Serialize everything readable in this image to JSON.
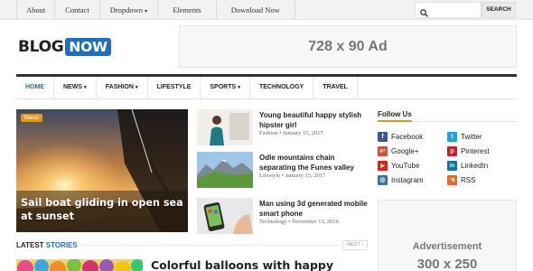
{
  "topbar": {
    "links": [
      "About",
      "Contact",
      "Dropdown",
      "Elements",
      "Download Now"
    ],
    "search_placeholder": "",
    "search_button": "SEARCH"
  },
  "header": {
    "logo_part1": "BLOG",
    "logo_part2": "NOW",
    "ad_text": "728 x 90 Ad"
  },
  "mainnav": {
    "items": [
      "HOME",
      "NEWS",
      "FASHION",
      "LIFESTYLE",
      "SPORTS",
      "TECHNOLOGY",
      "TRAVEL"
    ]
  },
  "featured": {
    "badge": "News",
    "title": "Sail boat gliding in open sea at sunset"
  },
  "articles": [
    {
      "title": "Young beautiful happy stylish hipster girl",
      "category": "Fashion",
      "date": "January 15, 2017"
    },
    {
      "title": "Odle mountains chain separating the Funes valley",
      "category": "Lifestyle",
      "date": "January 15, 2017"
    },
    {
      "title": "Man using 3d generated mobile smart phone",
      "category": "Technology",
      "date": "November 13, 2016"
    }
  ],
  "sidebar": {
    "follow_heading": "Follow Us",
    "social": [
      {
        "label": "Facebook",
        "icon": "facebook-icon",
        "glyph": "f",
        "color": "#3b5998"
      },
      {
        "label": "Twitter",
        "icon": "twitter-icon",
        "glyph": "t",
        "color": "#1da1f2"
      },
      {
        "label": "Google+",
        "icon": "google-plus-icon",
        "glyph": "g+",
        "color": "#dd4b39"
      },
      {
        "label": "Pinterest",
        "icon": "pinterest-icon",
        "glyph": "p",
        "color": "#cb2027"
      },
      {
        "label": "YouTube",
        "icon": "youtube-icon",
        "glyph": "▶",
        "color": "#e62117"
      },
      {
        "label": "LinkedIn",
        "icon": "linkedin-icon",
        "glyph": "in",
        "color": "#0e76a8"
      },
      {
        "label": "Instagram",
        "icon": "instagram-icon",
        "glyph": "◎",
        "color": "#3f729b"
      },
      {
        "label": "RSS",
        "icon": "rss-icon",
        "glyph": "◥",
        "color": "#f26522"
      }
    ],
    "advert_label": "Advertisement",
    "advert_size": "300 x 250"
  },
  "latest": {
    "label_part1": "LATEST",
    "label_part2": "STORIES",
    "next_label": "NEXT",
    "first_title": "Colorful balloons with happy"
  },
  "colors": {
    "accent": "#1f6fc0",
    "badge": "#e09a1d",
    "topbar_bg": "#f2f2f2"
  }
}
